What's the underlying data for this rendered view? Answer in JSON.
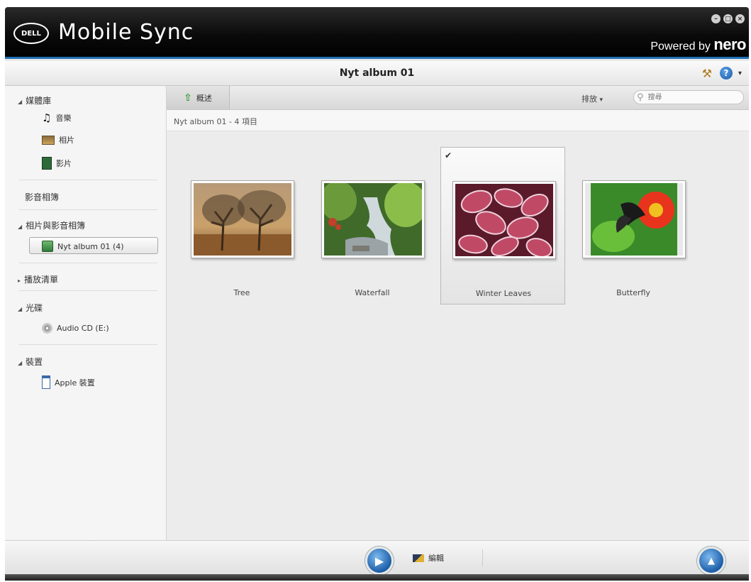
{
  "app": {
    "title": "Mobile Sync",
    "logo_text": "DELL",
    "powered_by": "Powered by",
    "brand": "nero"
  },
  "window_controls": [
    "minimize-icon",
    "maximize-icon",
    "close-icon"
  ],
  "header": {
    "title": "Nyt album 01",
    "tools": [
      "hammer-icon",
      "help-icon"
    ]
  },
  "sidebar": {
    "library": {
      "label": "媒體庫",
      "items": [
        {
          "label": "音樂",
          "icon": "music-note-icon"
        },
        {
          "label": "相片",
          "icon": "photo-icon"
        },
        {
          "label": "影片",
          "icon": "film-icon"
        }
      ]
    },
    "media_albums": {
      "label": "影音相簿"
    },
    "photo_video_albums": {
      "label": "相片與影音相簿",
      "items": [
        {
          "label": "Nyt album 01 (4)",
          "icon": "album-icon",
          "selected": true
        }
      ]
    },
    "playlists": {
      "label": "播放清單"
    },
    "discs": {
      "label": "光碟",
      "items": [
        {
          "label": "Audio CD (E:)",
          "icon": "cd-icon"
        }
      ]
    },
    "devices": {
      "label": "裝置",
      "items": [
        {
          "label": "Apple 裝置",
          "icon": "device-icon"
        }
      ]
    }
  },
  "toolbar": {
    "overview_label": "概述",
    "sort_label": "排放",
    "search_placeholder": "搜尋"
  },
  "breadcrumb": "Nyt album 01 - 4 項目",
  "items": [
    {
      "caption": "Tree",
      "selected": false
    },
    {
      "caption": "Waterfall",
      "selected": false
    },
    {
      "caption": "Winter Leaves",
      "selected": true
    },
    {
      "caption": "Butterfly",
      "selected": false
    }
  ],
  "footer": {
    "edit_label": "編輯"
  },
  "colors": {
    "accent": "#1f6fb5",
    "titlebar": "#0a0a0a"
  }
}
